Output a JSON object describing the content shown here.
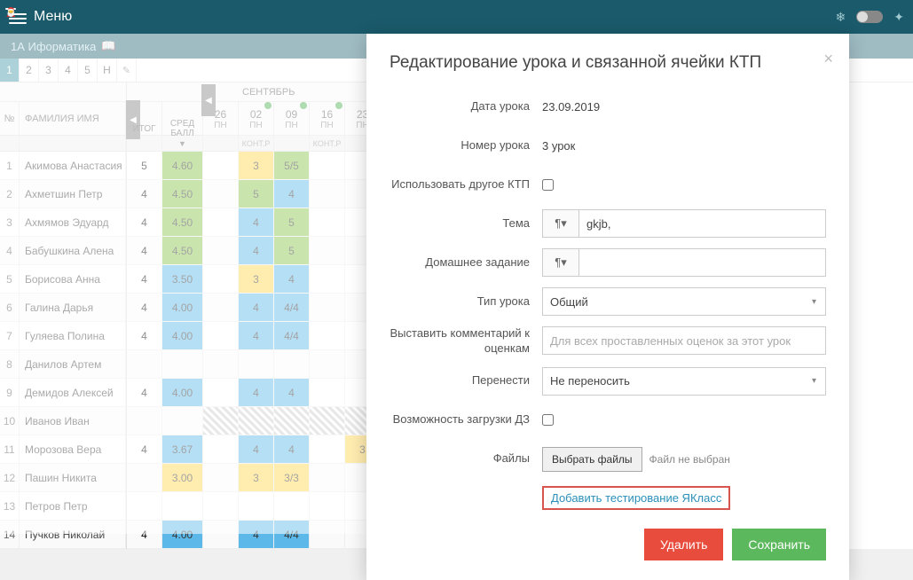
{
  "header": {
    "menu_label": "Меню"
  },
  "subheader": {
    "class_name": "1А Иформатика"
  },
  "tabs": [
    "1",
    "2",
    "3",
    "4",
    "5",
    "Н"
  ],
  "columns": {
    "num": "№",
    "name": "ФАМИЛИЯ ИМЯ",
    "itog": "ИТОГ",
    "avg": "СРЕД БАЛЛ"
  },
  "month": "СЕНТЯБРЬ",
  "dates": [
    {
      "d": "26",
      "dow": "ПН",
      "sub": ""
    },
    {
      "d": "02",
      "dow": "ПН",
      "ya": true,
      "sub": "КОНТ.Р"
    },
    {
      "d": "09",
      "dow": "ПН",
      "ya": true,
      "sub": ""
    },
    {
      "d": "16",
      "dow": "ПН",
      "ya": true,
      "sub": "КОНТ.Р"
    },
    {
      "d": "23",
      "dow": "ПН",
      "sub": ""
    }
  ],
  "students": [
    {
      "n": "1",
      "name": "Акимова Анастасия",
      "itog": "5",
      "avg": "4.60",
      "avgc": "green-avg",
      "marks": [
        "",
        "3",
        "5/5",
        "",
        ""
      ],
      "mc": [
        "",
        "yellow-cell",
        "green-cell",
        "",
        ""
      ]
    },
    {
      "n": "2",
      "name": "Ахметшин Петр",
      "itog": "4",
      "avg": "4.50",
      "avgc": "green-avg",
      "marks": [
        "",
        "5",
        "4",
        "",
        ""
      ],
      "mc": [
        "",
        "green-cell",
        "blue-cell",
        "",
        ""
      ]
    },
    {
      "n": "3",
      "name": "Ахмямов Эдуард",
      "itog": "4",
      "avg": "4.50",
      "avgc": "green-avg",
      "marks": [
        "",
        "4",
        "5",
        "",
        ""
      ],
      "mc": [
        "",
        "blue-cell",
        "green-cell",
        "",
        ""
      ]
    },
    {
      "n": "4",
      "name": "Бабушкина Алена",
      "itog": "4",
      "avg": "4.50",
      "avgc": "green-avg",
      "marks": [
        "",
        "4",
        "5",
        "",
        ""
      ],
      "mc": [
        "",
        "blue-cell",
        "green-cell",
        "",
        ""
      ]
    },
    {
      "n": "5",
      "name": "Борисова Анна",
      "itog": "4",
      "avg": "3.50",
      "avgc": "blue-avg",
      "marks": [
        "",
        "3",
        "4",
        "",
        ""
      ],
      "mc": [
        "",
        "yellow-cell",
        "blue-cell",
        "",
        ""
      ]
    },
    {
      "n": "6",
      "name": "Галина Дарья",
      "itog": "4",
      "avg": "4.00",
      "avgc": "blue-avg",
      "marks": [
        "",
        "4",
        "4/4",
        "",
        ""
      ],
      "mc": [
        "",
        "blue-cell",
        "blue-cell",
        "",
        ""
      ]
    },
    {
      "n": "7",
      "name": "Гуляева Полина",
      "itog": "4",
      "avg": "4.00",
      "avgc": "blue-avg",
      "marks": [
        "",
        "4",
        "4/4",
        "",
        ""
      ],
      "mc": [
        "",
        "blue-cell",
        "blue-cell",
        "",
        ""
      ]
    },
    {
      "n": "8",
      "name": "Данилов Артем",
      "itog": "",
      "avg": "",
      "avgc": "",
      "marks": [
        "",
        "",
        "",
        "",
        ""
      ],
      "mc": [
        "",
        "",
        "",
        "",
        ""
      ]
    },
    {
      "n": "9",
      "name": "Демидов Алексей",
      "itog": "4",
      "avg": "4.00",
      "avgc": "blue-avg",
      "marks": [
        "",
        "4",
        "4",
        "",
        ""
      ],
      "mc": [
        "",
        "blue-cell",
        "blue-cell",
        "",
        ""
      ]
    },
    {
      "n": "10",
      "name": "Иванов Иван",
      "itog": "",
      "avg": "",
      "avgc": "",
      "marks": [
        "",
        "",
        "",
        "",
        ""
      ],
      "mc": [
        "hatched",
        "hatched",
        "hatched",
        "hatched",
        "hatched"
      ]
    },
    {
      "n": "11",
      "name": "Морозова Вера",
      "itog": "4",
      "avg": "3.67",
      "avgc": "blue-avg",
      "marks": [
        "",
        "4",
        "4",
        "",
        "3"
      ],
      "mc": [
        "",
        "blue-cell",
        "blue-cell",
        "",
        "yellow-cell"
      ]
    },
    {
      "n": "12",
      "name": "Пашин Никита",
      "itog": "",
      "avg": "3.00",
      "avgc": "yellow-cell",
      "marks": [
        "",
        "3",
        "3/3",
        "",
        ""
      ],
      "mc": [
        "",
        "yellow-cell",
        "yellow-cell",
        "",
        ""
      ]
    },
    {
      "n": "13",
      "name": "Петров Петр",
      "itog": "",
      "avg": "",
      "avgc": "",
      "marks": [
        "",
        "",
        "",
        "",
        ""
      ],
      "mc": [
        "",
        "",
        "",
        "",
        ""
      ]
    },
    {
      "n": "14",
      "name": "Пучков Николай",
      "itog": "4",
      "avg": "4.00",
      "avgc": "blue-avg",
      "marks": [
        "",
        "4",
        "4/4",
        "",
        ""
      ],
      "mc": [
        "",
        "blue-cell",
        "blue-cell",
        "",
        ""
      ]
    }
  ],
  "modal": {
    "title": "Редактирование урока и связанной ячейки КТП",
    "labels": {
      "date": "Дата урока",
      "lesson_num": "Номер урока",
      "other_ktp": "Использовать другое КТП",
      "topic": "Тема",
      "homework": "Домашнее задание",
      "lesson_type": "Тип урока",
      "comment": "Выставить комментарий к оценкам",
      "transfer": "Перенести",
      "upload_hw": "Возможность загрузки ДЗ",
      "files": "Файлы"
    },
    "values": {
      "date": "23.09.2019",
      "lesson_num": "3 урок",
      "topic": "gkjb,",
      "lesson_type": "Общий",
      "comment_placeholder": "Для всех проставленных оценок за этот урок",
      "transfer": "Не переносить",
      "choose_files": "Выбрать файлы",
      "no_file": "Файл не выбран"
    },
    "link": "Добавить тестирование ЯКласс",
    "buttons": {
      "delete": "Удалить",
      "save": "Сохранить"
    },
    "pilcrow": "¶▾"
  }
}
